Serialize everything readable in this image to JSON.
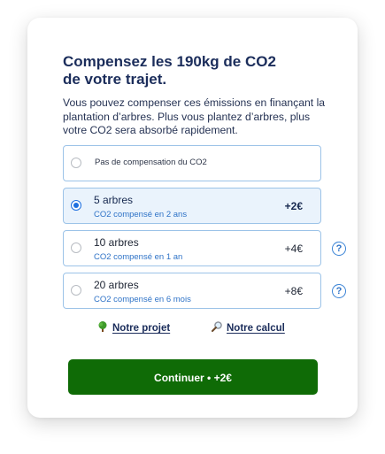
{
  "title": "Compensez les 190kg de CO2 de votre trajet.",
  "description": "Vous pouvez compenser ces émissions en finançant la plantation d’arbres. Plus vous plantez d’arbres, plus votre CO2 sera absorbé rapidement.",
  "options": [
    {
      "label": "Pas de compensation du CO2",
      "selected": false
    },
    {
      "label": "5 arbres",
      "sub": "CO2 compensé en 2 ans",
      "price": "+2€",
      "selected": true
    },
    {
      "label": "10 arbres",
      "sub": "CO2 compensé en 1 an",
      "price": "+4€",
      "selected": false,
      "help": "?"
    },
    {
      "label": "20 arbres",
      "sub": "CO2 compensé en 6 mois",
      "price": "+8€",
      "selected": false,
      "help": "?"
    }
  ],
  "links": {
    "project": {
      "label": "Notre projet",
      "icon": "tree-icon"
    },
    "calculation": {
      "label": "Notre calcul",
      "icon": "magnifier-icon"
    }
  },
  "cta": {
    "label": "Continuer • +2€"
  },
  "colors": {
    "accent": "#1d6fe0",
    "cta": "#0f6b06",
    "title": "#1b2d5b"
  }
}
